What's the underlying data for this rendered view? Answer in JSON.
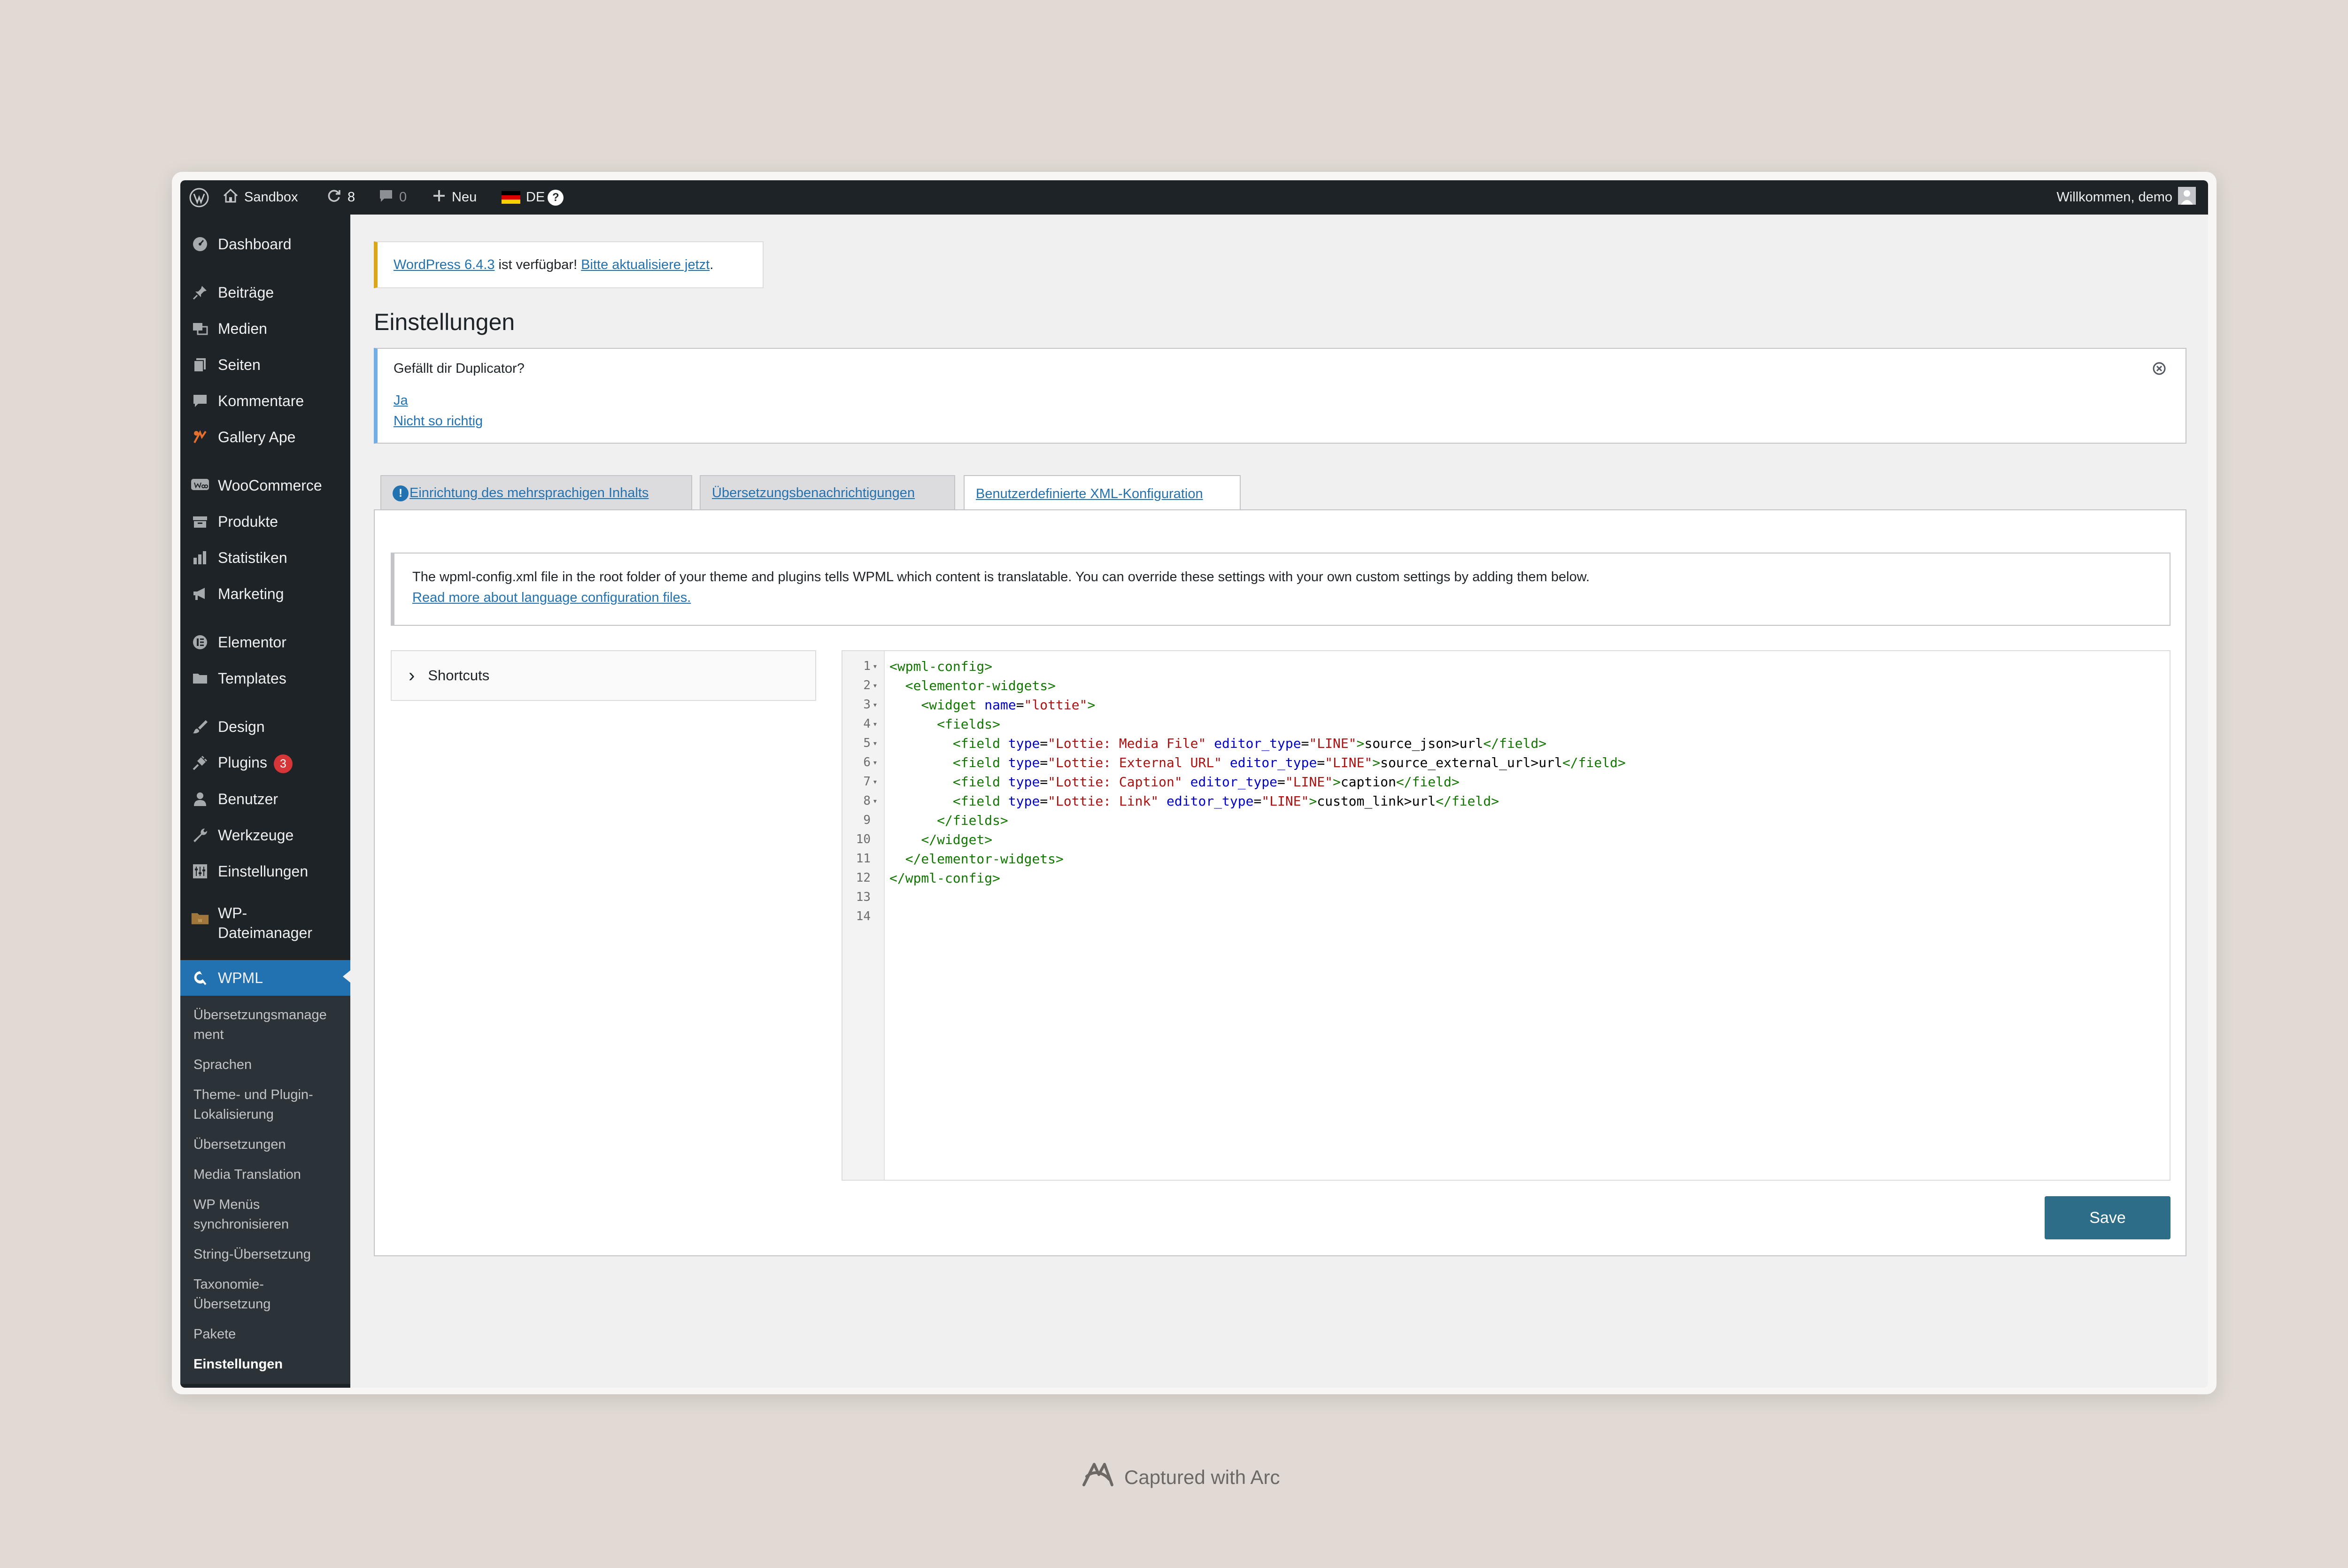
{
  "admin_bar": {
    "site_name": "Sandbox",
    "updates_count": "8",
    "comments_count": "0",
    "new_label": "Neu",
    "language": "DE",
    "help_glyph": "?",
    "greeting": "Willkommen, demo"
  },
  "sidebar": {
    "items": [
      {
        "label": "Dashboard",
        "icon": "dashboard-icon"
      },
      {
        "label": "Beiträge",
        "icon": "pin-icon"
      },
      {
        "label": "Medien",
        "icon": "media-icon"
      },
      {
        "label": "Seiten",
        "icon": "pages-icon"
      },
      {
        "label": "Kommentare",
        "icon": "comments-icon"
      },
      {
        "label": "Gallery Ape",
        "icon": "gallery-ape-icon"
      },
      {
        "label": "WooCommerce",
        "icon": "woo-icon"
      },
      {
        "label": "Produkte",
        "icon": "products-icon"
      },
      {
        "label": "Statistiken",
        "icon": "stats-icon"
      },
      {
        "label": "Marketing",
        "icon": "megaphone-icon"
      },
      {
        "label": "Elementor",
        "icon": "elementor-icon"
      },
      {
        "label": "Templates",
        "icon": "folder-icon"
      },
      {
        "label": "Design",
        "icon": "brush-icon"
      },
      {
        "label": "Plugins",
        "icon": "plugin-icon",
        "badge": "3"
      },
      {
        "label": "Benutzer",
        "icon": "user-icon"
      },
      {
        "label": "Werkzeuge",
        "icon": "wrench-icon"
      },
      {
        "label": "Einstellungen",
        "icon": "settings-icon"
      },
      {
        "label": "WP-Dateimanager",
        "label_line1": "WP-",
        "label_line2": "Dateimanager",
        "icon": "file-manager-icon"
      },
      {
        "label": "WPML",
        "icon": "wpml-icon",
        "current": true
      }
    ],
    "submenu": [
      {
        "line1": "Übersetzungsmanage",
        "line2": "ment"
      },
      {
        "line1": "Sprachen"
      },
      {
        "line1": "Theme- und Plugin-",
        "line2": "Lokalisierung"
      },
      {
        "line1": "Übersetzungen"
      },
      {
        "line1": "Media Translation"
      },
      {
        "line1": "WP Menüs",
        "line2": "synchronisieren"
      },
      {
        "line1": "String-Übersetzung"
      },
      {
        "line1": "Taxonomie-",
        "line2": "Übersetzung"
      },
      {
        "line1": "Pakete"
      },
      {
        "line1": "Einstellungen",
        "current": true
      }
    ]
  },
  "update_notice": {
    "version_link": "WordPress 6.4.3",
    "text": " ist verfügbar! ",
    "update_link": "Bitte aktualisiere jetzt",
    "end": "."
  },
  "page_title": "Einstellungen",
  "duplicator_notice": {
    "question": "Gefällt dir Duplicator?",
    "yes": "Ja",
    "no": "Nicht so richtig",
    "close_glyph": "×"
  },
  "tabs": [
    {
      "label": "Einrichtung des mehrsprachigen Inhalts",
      "warn": "!"
    },
    {
      "label": "Übersetzungsbenachrichtigungen"
    },
    {
      "label": "Benutzerdefinierte XML-Konfiguration",
      "active": true
    }
  ],
  "info_box": {
    "text": "The wpml-config.xml file in the root folder of your theme and plugins tells WPML which content is translatable. You can override these settings with your own custom settings by adding them below.",
    "link": "Read more about language configuration files."
  },
  "shortcuts": {
    "label": "Shortcuts",
    "chevron": "›"
  },
  "editor": {
    "line_numbers": [
      "1",
      "2",
      "3",
      "4",
      "5",
      "6",
      "7",
      "8",
      "9",
      "10",
      "11",
      "12",
      "13",
      "14"
    ],
    "fold_marker": "▾",
    "lines": [
      {
        "indent": "",
        "parts": [
          {
            "c": "t",
            "v": "<wpml-config>"
          }
        ]
      },
      {
        "indent": "  ",
        "parts": [
          {
            "c": "t",
            "v": "<elementor-widgets>"
          }
        ]
      },
      {
        "indent": "    ",
        "parts": [
          {
            "c": "t",
            "v": "<widget "
          },
          {
            "c": "a",
            "v": "name"
          },
          {
            "c": "",
            "v": "="
          },
          {
            "c": "s",
            "v": "\"lottie\""
          },
          {
            "c": "t",
            "v": ">"
          }
        ]
      },
      {
        "indent": "      ",
        "parts": [
          {
            "c": "t",
            "v": "<fields>"
          }
        ]
      },
      {
        "indent": "        ",
        "parts": [
          {
            "c": "t",
            "v": "<field "
          },
          {
            "c": "a",
            "v": "type"
          },
          {
            "c": "",
            "v": "="
          },
          {
            "c": "s",
            "v": "\"Lottie: Media File\""
          },
          {
            "c": "",
            "v": " "
          },
          {
            "c": "a",
            "v": "editor_type"
          },
          {
            "c": "",
            "v": "="
          },
          {
            "c": "s",
            "v": "\"LINE\""
          },
          {
            "c": "t",
            "v": ">"
          },
          {
            "c": "",
            "v": "source_json>url"
          },
          {
            "c": "t",
            "v": "</field>"
          }
        ]
      },
      {
        "indent": "        ",
        "parts": [
          {
            "c": "t",
            "v": "<field "
          },
          {
            "c": "a",
            "v": "type"
          },
          {
            "c": "",
            "v": "="
          },
          {
            "c": "s",
            "v": "\"Lottie: External URL\""
          },
          {
            "c": "",
            "v": " "
          },
          {
            "c": "a",
            "v": "editor_type"
          },
          {
            "c": "",
            "v": "="
          },
          {
            "c": "s",
            "v": "\"LINE\""
          },
          {
            "c": "t",
            "v": ">"
          },
          {
            "c": "",
            "v": "source_external_url>url"
          },
          {
            "c": "t",
            "v": "</field>"
          }
        ]
      },
      {
        "indent": "        ",
        "parts": [
          {
            "c": "t",
            "v": "<field "
          },
          {
            "c": "a",
            "v": "type"
          },
          {
            "c": "",
            "v": "="
          },
          {
            "c": "s",
            "v": "\"Lottie: Caption\""
          },
          {
            "c": "",
            "v": " "
          },
          {
            "c": "a",
            "v": "editor_type"
          },
          {
            "c": "",
            "v": "="
          },
          {
            "c": "s",
            "v": "\"LINE\""
          },
          {
            "c": "t",
            "v": ">"
          },
          {
            "c": "",
            "v": "caption"
          },
          {
            "c": "t",
            "v": "</field>"
          }
        ]
      },
      {
        "indent": "        ",
        "parts": [
          {
            "c": "t",
            "v": "<field "
          },
          {
            "c": "a",
            "v": "type"
          },
          {
            "c": "",
            "v": "="
          },
          {
            "c": "s",
            "v": "\"Lottie: Link\""
          },
          {
            "c": "",
            "v": " "
          },
          {
            "c": "a",
            "v": "editor_type"
          },
          {
            "c": "",
            "v": "="
          },
          {
            "c": "s",
            "v": "\"LINE\""
          },
          {
            "c": "t",
            "v": ">"
          },
          {
            "c": "",
            "v": "custom_link>url"
          },
          {
            "c": "t",
            "v": "</field>"
          }
        ]
      },
      {
        "indent": "      ",
        "parts": [
          {
            "c": "t",
            "v": "</fields>"
          }
        ]
      },
      {
        "indent": "    ",
        "parts": [
          {
            "c": "t",
            "v": "</widget>"
          }
        ]
      },
      {
        "indent": "  ",
        "parts": [
          {
            "c": "t",
            "v": "</elementor-widgets>"
          }
        ]
      },
      {
        "indent": "",
        "parts": [
          {
            "c": "t",
            "v": "</wpml-config>"
          }
        ]
      },
      {
        "indent": "",
        "parts": []
      },
      {
        "indent": "",
        "parts": []
      }
    ]
  },
  "save_label": "Save",
  "footer": {
    "credit": "Captured with Arc"
  },
  "colors": {
    "admin_bar": "#1d2327",
    "accent": "#2271b1",
    "save_button": "#2d6d87",
    "warning_border": "#dba617",
    "info_border": "#72aee6",
    "badge": "#d63638"
  }
}
